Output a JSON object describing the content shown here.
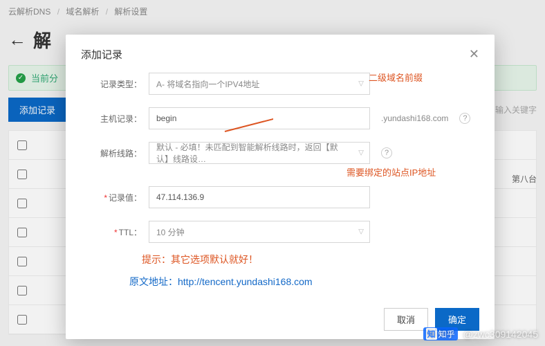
{
  "breadcrumbs": {
    "a": "云解析DNS",
    "b": "域名解析",
    "c": "解析设置",
    "sep": "/"
  },
  "bg": {
    "back_glyph": "←",
    "title_fragment": "解",
    "alert_prefix": "当前分",
    "add_button": "添加记录",
    "search_placeholder": "输入关键字",
    "side_note": "第八台"
  },
  "modal": {
    "title": "添加记录",
    "fields": {
      "type": {
        "label": "记录类型：",
        "value": "A- 将域名指向一个IPV4地址"
      },
      "host": {
        "label": "主机记录：",
        "value": "begin",
        "suffix": ".yundashi168.com"
      },
      "line": {
        "label": "解析线路：",
        "value": "默认 - 必填！未匹配到智能解析线路时，返回【默认】线路设…"
      },
      "val": {
        "label": "记录值：",
        "value": "47.114.136.9"
      },
      "ttl": {
        "label": "TTL：",
        "value": "10 分钟"
      }
    },
    "annotations": {
      "a1": "二级域名前缀",
      "a2": "需要绑定的站点IP地址",
      "tip": "提示：其它选项默认就好！",
      "origin": "原文地址：http://tencent.yundashi168.com"
    },
    "buttons": {
      "cancel": "取消",
      "ok": "确定"
    }
  },
  "watermark": {
    "label": "知乎",
    "user": "@zwc309142045"
  }
}
